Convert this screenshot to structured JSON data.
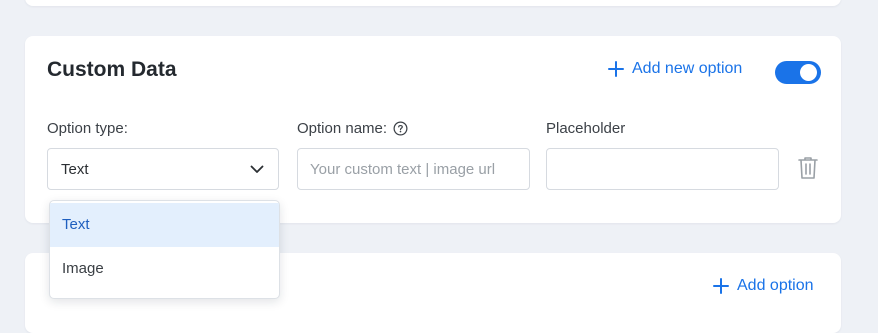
{
  "custom_data": {
    "title": "Custom Data",
    "add_new_option_label": "Add new option",
    "toggle_on": true,
    "option_type_label": "Option type:",
    "option_name_label": "Option name:",
    "placeholder_label": "Placeholder",
    "option_type_value": "Text",
    "option_name_placeholder": "Your custom text | image url",
    "placeholder_value": "",
    "dropdown_options": [
      "Text",
      "Image"
    ],
    "selected_option": "Text"
  },
  "next_card": {
    "add_option_label": "Add option"
  },
  "colors": {
    "accent": "#1a73e8",
    "background": "#eef1f6",
    "selected_bg": "#e3effd"
  },
  "icons": [
    "plus-icon",
    "toggle-switch",
    "help-icon",
    "chevron-down-icon",
    "trash-icon"
  ]
}
